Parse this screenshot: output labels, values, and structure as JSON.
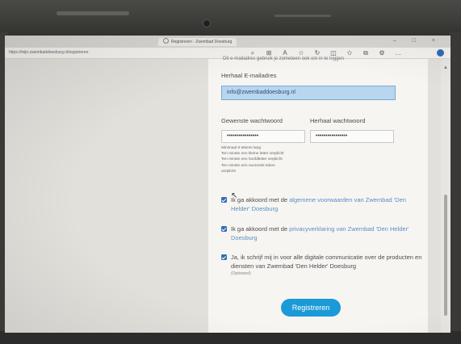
{
  "browser": {
    "tab_title": "Registreren - Zwembad Doesburg",
    "window_controls": "– □ ×",
    "url": "https://mijn.zwembaddoesburg.nl/registreren",
    "toolbar_icons": [
      "search-icon",
      "translate-icon",
      "read-aloud-icon",
      "favorite-icon",
      "refresh-icon",
      "split-screen-icon",
      "favorites-icon",
      "collections-icon",
      "extensions-icon",
      "more-icon"
    ]
  },
  "form": {
    "clipped_top_text": "Dit e-mailadres gebruik je zometeen ook om in te loggen",
    "repeat_email_label": "Herhaal E-mailadres",
    "repeat_email_value": "info@zwembaddoesburg.nl",
    "password_label": "Gewenste wachtwoord",
    "repeat_password_label": "Herhaal wachtwoord",
    "password_value": "••••••••••••••••",
    "repeat_password_value": "••••••••••••••••",
    "requirements": [
      "Minimaal 8 tekens lang",
      "Ten minste een kleine letter verplicht",
      "Ten minste een hoofdletter verplicht",
      "Ten minste een numeriek teken",
      "verplicht"
    ],
    "terms": {
      "prefix": "Ik ga akkoord met de ",
      "link": "algemene voorwaarden van Zwembad 'Den Helder' Doesburg"
    },
    "privacy": {
      "prefix": "Ik ga akkoord met de ",
      "link": "privacyverklaring van Zwembad 'Den Helder' Doesburg"
    },
    "newsletter": {
      "text": "Ja, ik schrijf mij in voor alle digitale communicatie over de producten en diensten van Zwembad 'Den Helder' Doesburg",
      "optional": "(Optioneel)"
    },
    "submit_label": "Registreren"
  },
  "colors": {
    "accent": "#1a9ad6",
    "checkbox": "#2f6db5",
    "link": "#5b8ec4",
    "focused_field": "#b8d6ee"
  }
}
